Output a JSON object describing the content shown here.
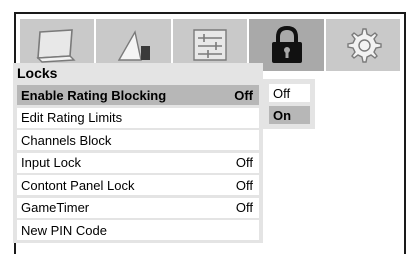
{
  "tabs": [
    {
      "icon": "picture-icon"
    },
    {
      "icon": "sound-icon"
    },
    {
      "icon": "settings-list-icon"
    },
    {
      "icon": "lock-icon",
      "active": true
    },
    {
      "icon": "gear-icon"
    }
  ],
  "menu": {
    "title": "Locks",
    "items": [
      {
        "label": "Enable Rating Blocking",
        "value": "Off",
        "selected": true
      },
      {
        "label": "Edit Rating Limits",
        "value": ""
      },
      {
        "label": "Channels Block",
        "value": ""
      },
      {
        "label": "Input Lock",
        "value": "Off"
      },
      {
        "label": "Contont Panel Lock",
        "value": "Off"
      },
      {
        "label": "GameTimer",
        "value": "Off"
      },
      {
        "label": "New PIN Code",
        "value": ""
      }
    ]
  },
  "popup": {
    "options": [
      "Off",
      "On"
    ],
    "highlighted": "On"
  },
  "colors": {
    "tabbar": "#c9c9c9",
    "tab_active": "#a9a9a9",
    "panel": "#e4e4e4",
    "selected_row": "#b7b7b7"
  }
}
